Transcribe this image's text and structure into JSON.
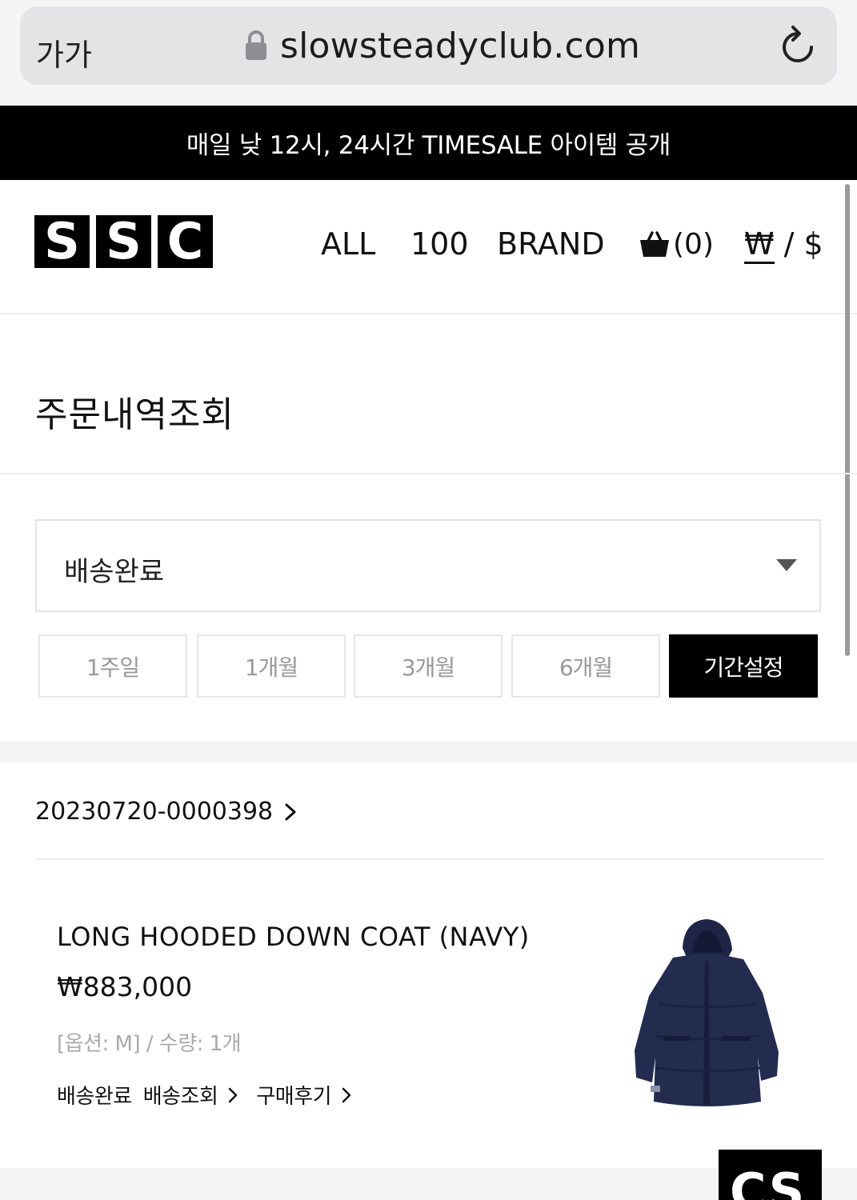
{
  "browser": {
    "text_size_label": "가가",
    "url": "slowsteadyclub.com",
    "lock_icon": "lock-icon",
    "reload_icon": "reload-icon"
  },
  "banner": {
    "text": "매일 낮 12시, 24시간 TIMESALE 아이템 공개"
  },
  "header": {
    "logo_letters": [
      "S",
      "S",
      "C"
    ],
    "nav": [
      "ALL",
      "100",
      "BRAND"
    ],
    "cart_icon": "shopping-basket-icon",
    "cart_count": "(0)",
    "currency_won": "₩",
    "currency_sep": " / ",
    "currency_usd": "$"
  },
  "page": {
    "title": "주문내역조회"
  },
  "filter": {
    "status_value": "배송완료",
    "periods": [
      "1주일",
      "1개월",
      "3개월",
      "6개월",
      "기간설정"
    ],
    "active_period": "기간설정"
  },
  "order": {
    "number": "20230720-0000398",
    "product_name": "LONG HOODED DOWN COAT (NAVY)",
    "price": "₩883,000",
    "option_text": "[옵션: M] / 수량: 1개",
    "status": "배송완료",
    "track_label": "배송조회",
    "review_label": "구매후기"
  },
  "cs_button": {
    "label": "CS"
  },
  "colors": {
    "banner_bg": "#000000",
    "coat_navy": "#232b4f"
  }
}
